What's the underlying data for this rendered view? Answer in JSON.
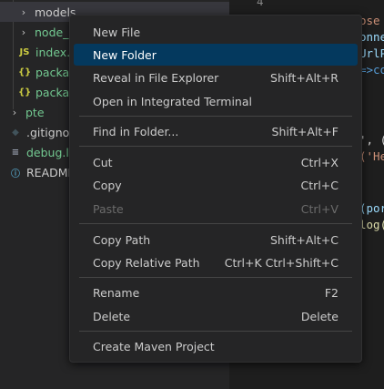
{
  "editor": {
    "line_number": "4",
    "code_fragments": [
      {
        "text": "ose",
        "color": "#ce9178"
      },
      {
        "text": "onne",
        "color": "#9cdcfe"
      },
      {
        "text": "UrlP",
        "color": "#9cdcfe"
      },
      {
        "text": "=>co",
        "color": "#569cd6"
      },
      {
        "text": "', (",
        "color": "#d4d4d4"
      },
      {
        "text": "('He",
        "color": "#ce9178"
      },
      {
        "text": "(por",
        "color": "#9cdcfe"
      },
      {
        "text": "log(",
        "color": "#dcdcaa"
      }
    ]
  },
  "sidebar": {
    "items": [
      {
        "label": "models",
        "icon": "chevron-right",
        "color": "#cccccc"
      },
      {
        "label": "node_m",
        "icon": "chevron-right",
        "color": "#73c991"
      },
      {
        "label": "index.js",
        "icon": "js-file",
        "badge": "JS",
        "color": "#73c991"
      },
      {
        "label": "packag",
        "icon": "json-file",
        "badge": "{}",
        "color": "#73c991"
      },
      {
        "label": "packag",
        "icon": "json-file",
        "badge": "{}",
        "color": "#73c991"
      },
      {
        "label": "pte",
        "icon": "chevron-right",
        "color": "#73c991"
      },
      {
        "label": ".gitignor",
        "icon": "git-file",
        "color": "#cccccc"
      },
      {
        "label": "debug.lo",
        "icon": "log-file",
        "color": "#73c991"
      },
      {
        "label": "README",
        "icon": "info-file",
        "color": "#cccccc"
      }
    ]
  },
  "menu": {
    "items": [
      {
        "label": "New File",
        "shortcut": "",
        "state": "normal"
      },
      {
        "label": "New Folder",
        "shortcut": "",
        "state": "highlighted"
      },
      {
        "label": "Reveal in File Explorer",
        "shortcut": "Shift+Alt+R",
        "state": "normal"
      },
      {
        "label": "Open in Integrated Terminal",
        "shortcut": "",
        "state": "normal"
      },
      {
        "label": "Find in Folder...",
        "shortcut": "Shift+Alt+F",
        "state": "normal"
      },
      {
        "label": "Cut",
        "shortcut": "Ctrl+X",
        "state": "normal"
      },
      {
        "label": "Copy",
        "shortcut": "Ctrl+C",
        "state": "normal"
      },
      {
        "label": "Paste",
        "shortcut": "Ctrl+V",
        "state": "disabled"
      },
      {
        "label": "Copy Path",
        "shortcut": "Shift+Alt+C",
        "state": "normal"
      },
      {
        "label": "Copy Relative Path",
        "shortcut": "Ctrl+K Ctrl+Shift+C",
        "state": "normal"
      },
      {
        "label": "Rename",
        "shortcut": "F2",
        "state": "normal"
      },
      {
        "label": "Delete",
        "shortcut": "Delete",
        "state": "normal"
      },
      {
        "label": "Create Maven Project",
        "shortcut": "",
        "state": "normal"
      }
    ]
  },
  "colors": {
    "highlight": "#04395e",
    "menu_bg": "#252526",
    "sidebar_bg": "#252526",
    "editor_bg": "#1e1e1e",
    "git_added": "#73c991",
    "js_icon": "#cbcb41",
    "json_icon": "#cbcb41",
    "info_icon": "#519aba"
  }
}
